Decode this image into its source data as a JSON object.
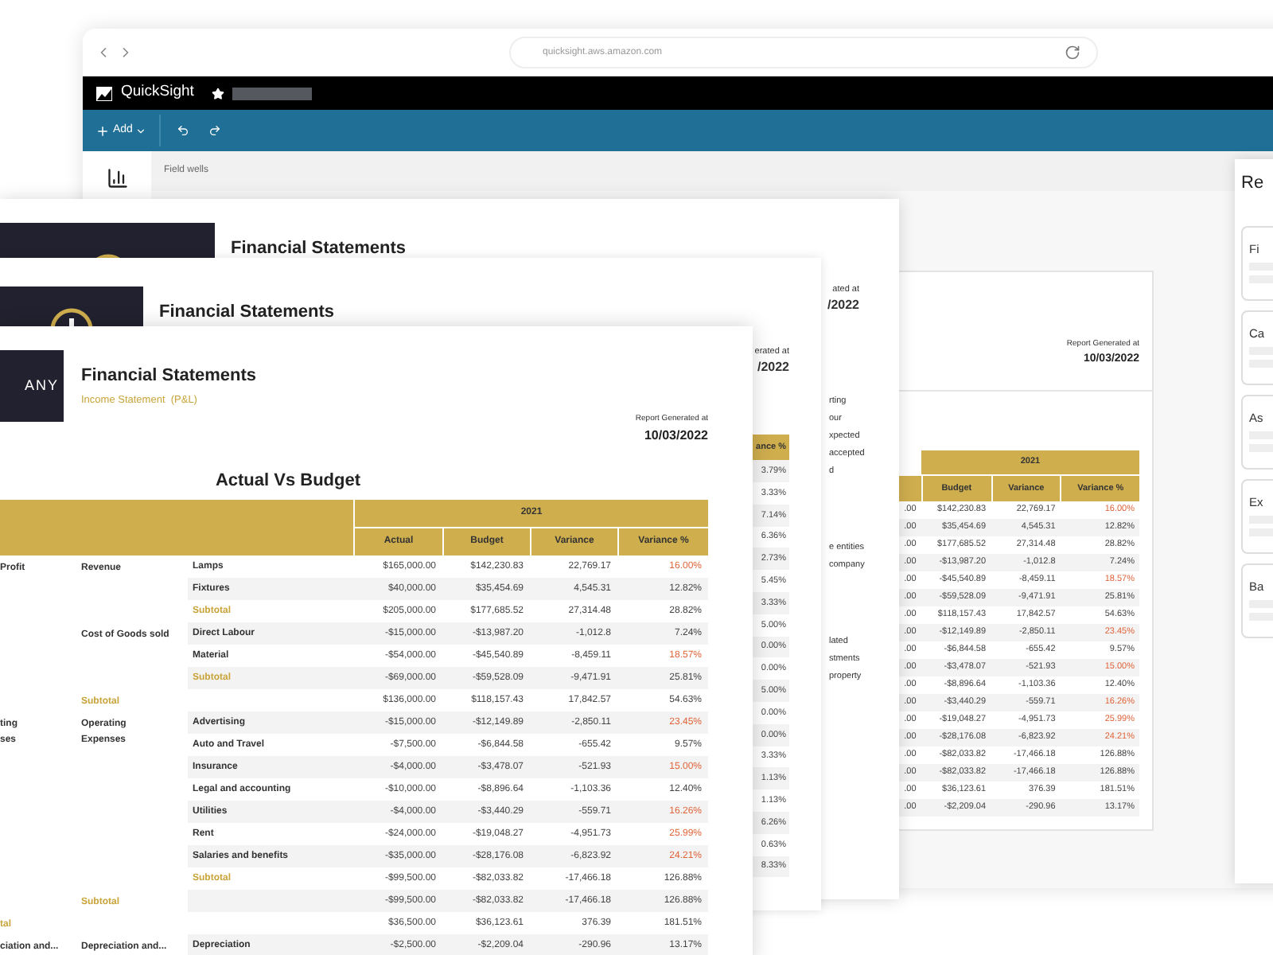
{
  "browser": {
    "url": "quicksight.aws.amazon.com"
  },
  "app": {
    "name": "QuickSight",
    "add_label": "Add",
    "field_wells_label": "Field wells"
  },
  "back_report": {
    "generated_label": "Report Generated at",
    "generated_date": "10/03/2022",
    "year": "2021",
    "columns": [
      "Budget",
      "Variance",
      "Variance %"
    ],
    "rows": [
      {
        "column_1": ".00",
        "budget": "$142,230.83",
        "variance": "22,769.17",
        "variance_pct": "16.00%",
        "over_budget": true
      },
      {
        "column_1": ".00",
        "budget": "$35,454.69",
        "variance": "4,545.31",
        "variance_pct": "12.82%",
        "over_budget": false
      },
      {
        "column_1": ".00",
        "budget": "$177,685.52",
        "variance": "27,314.48",
        "variance_pct": "28.82%",
        "over_budget": false
      },
      {
        "column_1": ".00",
        "budget": "-$13,987.20",
        "variance": "-1,012.8",
        "variance_pct": "7.24%",
        "over_budget": false
      },
      {
        "column_1": ".00",
        "budget": "-$45,540.89",
        "variance": "-8,459.11",
        "variance_pct": "18.57%",
        "over_budget": true
      },
      {
        "column_1": ".00",
        "budget": "-$59,528.09",
        "variance": "-9,471.91",
        "variance_pct": "25.81%",
        "over_budget": false
      },
      {
        "column_1": ".00",
        "budget": "$118,157.43",
        "variance": "17,842.57",
        "variance_pct": "54.63%",
        "over_budget": false
      },
      {
        "column_1": ".00",
        "budget": "-$12,149.89",
        "variance": "-2,850.11",
        "variance_pct": "23.45%",
        "over_budget": true
      },
      {
        "column_1": ".00",
        "budget": "-$6,844.58",
        "variance": "-655.42",
        "variance_pct": "9.57%",
        "over_budget": false
      },
      {
        "column_1": ".00",
        "budget": "-$3,478.07",
        "variance": "-521.93",
        "variance_pct": "15.00%",
        "over_budget": true
      },
      {
        "column_1": ".00",
        "budget": "-$8,896.64",
        "variance": "-1,103.36",
        "variance_pct": "12.40%",
        "over_budget": false
      },
      {
        "column_1": ".00",
        "budget": "-$3,440.29",
        "variance": "-559.71",
        "variance_pct": "16.26%",
        "over_budget": true
      },
      {
        "column_1": ".00",
        "budget": "-$19,048.27",
        "variance": "-4,951.73",
        "variance_pct": "25.99%",
        "over_budget": true
      },
      {
        "column_1": ".00",
        "budget": "-$28,176.08",
        "variance": "-6,823.92",
        "variance_pct": "24.21%",
        "over_budget": true
      },
      {
        "column_1": ".00",
        "budget": "-$82,033.82",
        "variance": "-17,466.18",
        "variance_pct": "126.88%",
        "over_budget": false
      },
      {
        "column_1": ".00",
        "budget": "-$82,033.82",
        "variance": "-17,466.18",
        "variance_pct": "126.88%",
        "over_budget": false
      },
      {
        "column_1": ".00",
        "budget": "$36,123.61",
        "variance": "376.39",
        "variance_pct": "181.51%",
        "over_budget": false
      },
      {
        "column_1": ".00",
        "budget": "-$2,209.04",
        "variance": "-290.96",
        "variance_pct": "13.17%",
        "over_budget": false
      }
    ]
  },
  "side_panel": {
    "title": "Re",
    "cards": [
      "Fi",
      "Ca",
      "As",
      "Ex",
      "Ba"
    ]
  },
  "sheet_3": {
    "title": "Financial Statements",
    "generated_label": "ated at",
    "generated_date": "/2022",
    "text_fragments": [
      {
        "lines": [
          "rting",
          "our",
          "xpected",
          "accepted",
          "d"
        ]
      },
      {
        "lines": [
          "e entities",
          "company"
        ]
      },
      {
        "lines": [
          "lated",
          "stments",
          "property"
        ]
      }
    ]
  },
  "sheet_2": {
    "title": "Financial Statements",
    "generated_label": "erated at",
    "generated_date": "/2022",
    "column_header": "ance %",
    "values": [
      "3.79%",
      "3.33%",
      "7.14%",
      "6.36%",
      "2.73%",
      "5.45%",
      "3.33%",
      "5.00%",
      "0.00%",
      "0.00%",
      "5.00%",
      "0.00%",
      "0.00%",
      "3.33%",
      "1.13%",
      "1.13%",
      "6.26%",
      "0.63%",
      "8.33%"
    ]
  },
  "report": {
    "logo_text": "ANY",
    "title": "Financial Statements",
    "subtitle": "Income Statement  (P&L)",
    "generated_label": "Report Generated at",
    "generated_date": "10/03/2022",
    "heading": "Actual Vs Budget",
    "year": "2021",
    "columns": [
      "Actual",
      "Budget",
      "Variance",
      "Variance %"
    ],
    "rows": [
      {
        "column_1": "Profit",
        "column_2": "Revenue",
        "column_3": "Lamps",
        "actual": "$165,000.00",
        "budget": "$142,230.83",
        "variance": "22,769.17",
        "variance_pct": "16.00%",
        "over_budget": true,
        "subtotal": false
      },
      {
        "column_3": "Fixtures",
        "actual": "$40,000.00",
        "budget": "$35,454.69",
        "variance": "4,545.31",
        "variance_pct": "12.82%",
        "over_budget": false,
        "subtotal": false
      },
      {
        "column_3": "Subtotal",
        "actual": "$205,000.00",
        "budget": "$177,685.52",
        "variance": "27,314.48",
        "variance_pct": "28.82%",
        "over_budget": false,
        "subtotal": true
      },
      {
        "column_2": "Cost of Goods sold",
        "column_3": "Direct Labour",
        "actual": "-$15,000.00",
        "budget": "-$13,987.20",
        "variance": "-1,012.8",
        "variance_pct": "7.24%",
        "over_budget": false,
        "subtotal": false,
        "label_wrap": false
      },
      {
        "column_3": "Material",
        "actual": "-$54,000.00",
        "budget": "-$45,540.89",
        "variance": "-8,459.11",
        "variance_pct": "18.57%",
        "over_budget": true,
        "subtotal": false
      },
      {
        "column_3": "Subtotal",
        "actual": "-$69,000.00",
        "budget": "-$59,528.09",
        "variance": "-9,471.91",
        "variance_pct": "25.81%",
        "over_budget": false,
        "subtotal": true
      },
      {
        "column_2": "Subtotal",
        "actual": "$136,000.00",
        "budget": "$118,157.43",
        "variance": "17,842.57",
        "variance_pct": "54.63%",
        "over_budget": false,
        "subtotal": true
      },
      {
        "column_1": "ting ses",
        "column_2": "Operating Expenses",
        "column_3": "Advertising",
        "actual": "-$15,000.00",
        "budget": "-$12,149.89",
        "variance": "-2,850.11",
        "variance_pct": "23.45%",
        "over_budget": true,
        "subtotal": false,
        "label_wrap": true
      },
      {
        "column_3": "Auto and Travel",
        "actual": "-$7,500.00",
        "budget": "-$6,844.58",
        "variance": "-655.42",
        "variance_pct": "9.57%",
        "over_budget": false,
        "subtotal": false
      },
      {
        "column_3": "Insurance",
        "actual": "-$4,000.00",
        "budget": "-$3,478.07",
        "variance": "-521.93",
        "variance_pct": "15.00%",
        "over_budget": true,
        "subtotal": false
      },
      {
        "column_3": "Legal and accounting",
        "actual": "-$10,000.00",
        "budget": "-$8,896.64",
        "variance": "-1,103.36",
        "variance_pct": "12.40%",
        "over_budget": false,
        "subtotal": false
      },
      {
        "column_3": "Utilities",
        "actual": "-$4,000.00",
        "budget": "-$3,440.29",
        "variance": "-559.71",
        "variance_pct": "16.26%",
        "over_budget": true,
        "subtotal": false
      },
      {
        "column_3": "Rent",
        "actual": "-$24,000.00",
        "budget": "-$19,048.27",
        "variance": "-4,951.73",
        "variance_pct": "25.99%",
        "over_budget": true,
        "subtotal": false
      },
      {
        "column_3": "Salaries and benefits",
        "actual": "-$35,000.00",
        "budget": "-$28,176.08",
        "variance": "-6,823.92",
        "variance_pct": "24.21%",
        "over_budget": true,
        "subtotal": false
      },
      {
        "column_3": "Subtotal",
        "actual": "-$99,500.00",
        "budget": "-$82,033.82",
        "variance": "-17,466.18",
        "variance_pct": "126.88%",
        "over_budget": false,
        "subtotal": true
      },
      {
        "column_2": "Subtotal",
        "actual": "-$99,500.00",
        "budget": "-$82,033.82",
        "variance": "-17,466.18",
        "variance_pct": "126.88%",
        "over_budget": false,
        "subtotal": true
      },
      {
        "column_1": "tal",
        "actual": "$36,500.00",
        "budget": "$36,123.61",
        "variance": "376.39",
        "variance_pct": "181.51%",
        "over_budget": false,
        "subtotal": true
      },
      {
        "column_1": "ciation and...",
        "column_2": "Depreciation and...",
        "column_3": "Depreciation",
        "actual": "-$2,500.00",
        "budget": "-$2,209.04",
        "variance": "-290.96",
        "variance_pct": "13.17%",
        "over_budget": false,
        "subtotal": false,
        "label_wrap": false
      }
    ]
  }
}
